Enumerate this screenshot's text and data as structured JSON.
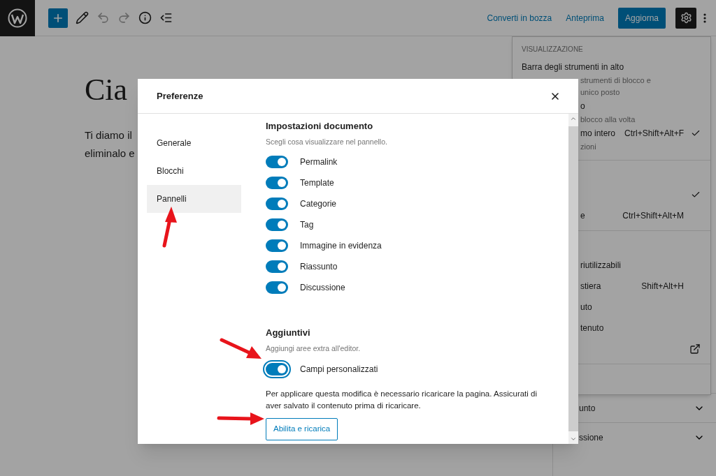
{
  "toolbar": {
    "tools": [
      {
        "kind": "add",
        "disabled": false
      },
      {
        "kind": "edit",
        "disabled": false
      },
      {
        "kind": "undo",
        "disabled": true
      },
      {
        "kind": "redo",
        "disabled": true
      },
      {
        "kind": "info",
        "disabled": false
      },
      {
        "kind": "list",
        "disabled": false
      }
    ],
    "links": [
      "Converti in bozza",
      "Anteprima"
    ],
    "primary_button": "Aggiorna",
    "settings_pressed": true
  },
  "editor": {
    "title": "Cia",
    "paragraph_lines": [
      "Ti diamo il",
      "eliminalo e"
    ]
  },
  "menu": {
    "groups": [
      {
        "rows": [
          {
            "kind": "heading",
            "text": "VISUALIZZAZIONE"
          },
          {
            "kind": "label",
            "text": "Barra degli strumenti in alto",
            "checked": false
          },
          {
            "kind": "note",
            "text": "strumenti di blocco e"
          },
          {
            "kind": "note",
            "text": "unico posto"
          },
          {
            "kind": "label",
            "text": "o",
            "checked": false
          },
          {
            "kind": "note",
            "text": "blocco alla volta"
          },
          {
            "kind": "label",
            "text": "mo intero",
            "shortcut": "Ctrl+Shift+Alt+F",
            "checked": true
          },
          {
            "kind": "note",
            "text": "zioni"
          }
        ]
      },
      {
        "rows": [
          {
            "kind": "item",
            "checked": true
          },
          {
            "kind": "item",
            "text": "e",
            "shortcut": "Ctrl+Shift+Alt+M",
            "checked": false
          }
        ]
      },
      {
        "rows": [
          {
            "kind": "item",
            "text": "riutilizzabili",
            "checked": false
          },
          {
            "kind": "item",
            "text": "stiera",
            "shortcut": "Shift+Alt+H",
            "checked": false
          },
          {
            "kind": "item",
            "text": "uto",
            "checked": false
          },
          {
            "kind": "item",
            "text": "tenuto",
            "checked": false
          },
          {
            "kind": "external"
          }
        ]
      }
    ]
  },
  "sidebar_panels": [
    {
      "text": "unto",
      "expanded": false
    },
    {
      "text": "ssione",
      "expanded": false
    }
  ],
  "dialog": {
    "title": "Preferenze",
    "nav": [
      {
        "label": "Generale",
        "selected": false
      },
      {
        "label": "Blocchi",
        "selected": false
      },
      {
        "label": "Pannelli",
        "selected": true
      }
    ],
    "sections": [
      {
        "title": "Impostazioni documento",
        "description": "Scegli cosa visualizzare nel pannello.",
        "toggles": [
          {
            "label": "Permalink",
            "on": true,
            "focused": false
          },
          {
            "label": "Template",
            "on": true,
            "focused": false
          },
          {
            "label": "Categorie",
            "on": true,
            "focused": false
          },
          {
            "label": "Tag",
            "on": true,
            "focused": false
          },
          {
            "label": "Immagine in evidenza",
            "on": true,
            "focused": false
          },
          {
            "label": "Riassunto",
            "on": true,
            "focused": false
          },
          {
            "label": "Discussione",
            "on": true,
            "focused": false
          }
        ]
      },
      {
        "title": "Aggiuntivi",
        "description": "Aggiungi aree extra all'editor.",
        "toggles": [
          {
            "label": "Campi personalizzati",
            "on": true,
            "focused": true
          }
        ],
        "notice": "Per applicare questa modifica è necessario ricaricare la pagina. Assicurati di aver salvato il contenuto prima di ricaricare.",
        "button": "Abilita e ricarica"
      }
    ]
  }
}
